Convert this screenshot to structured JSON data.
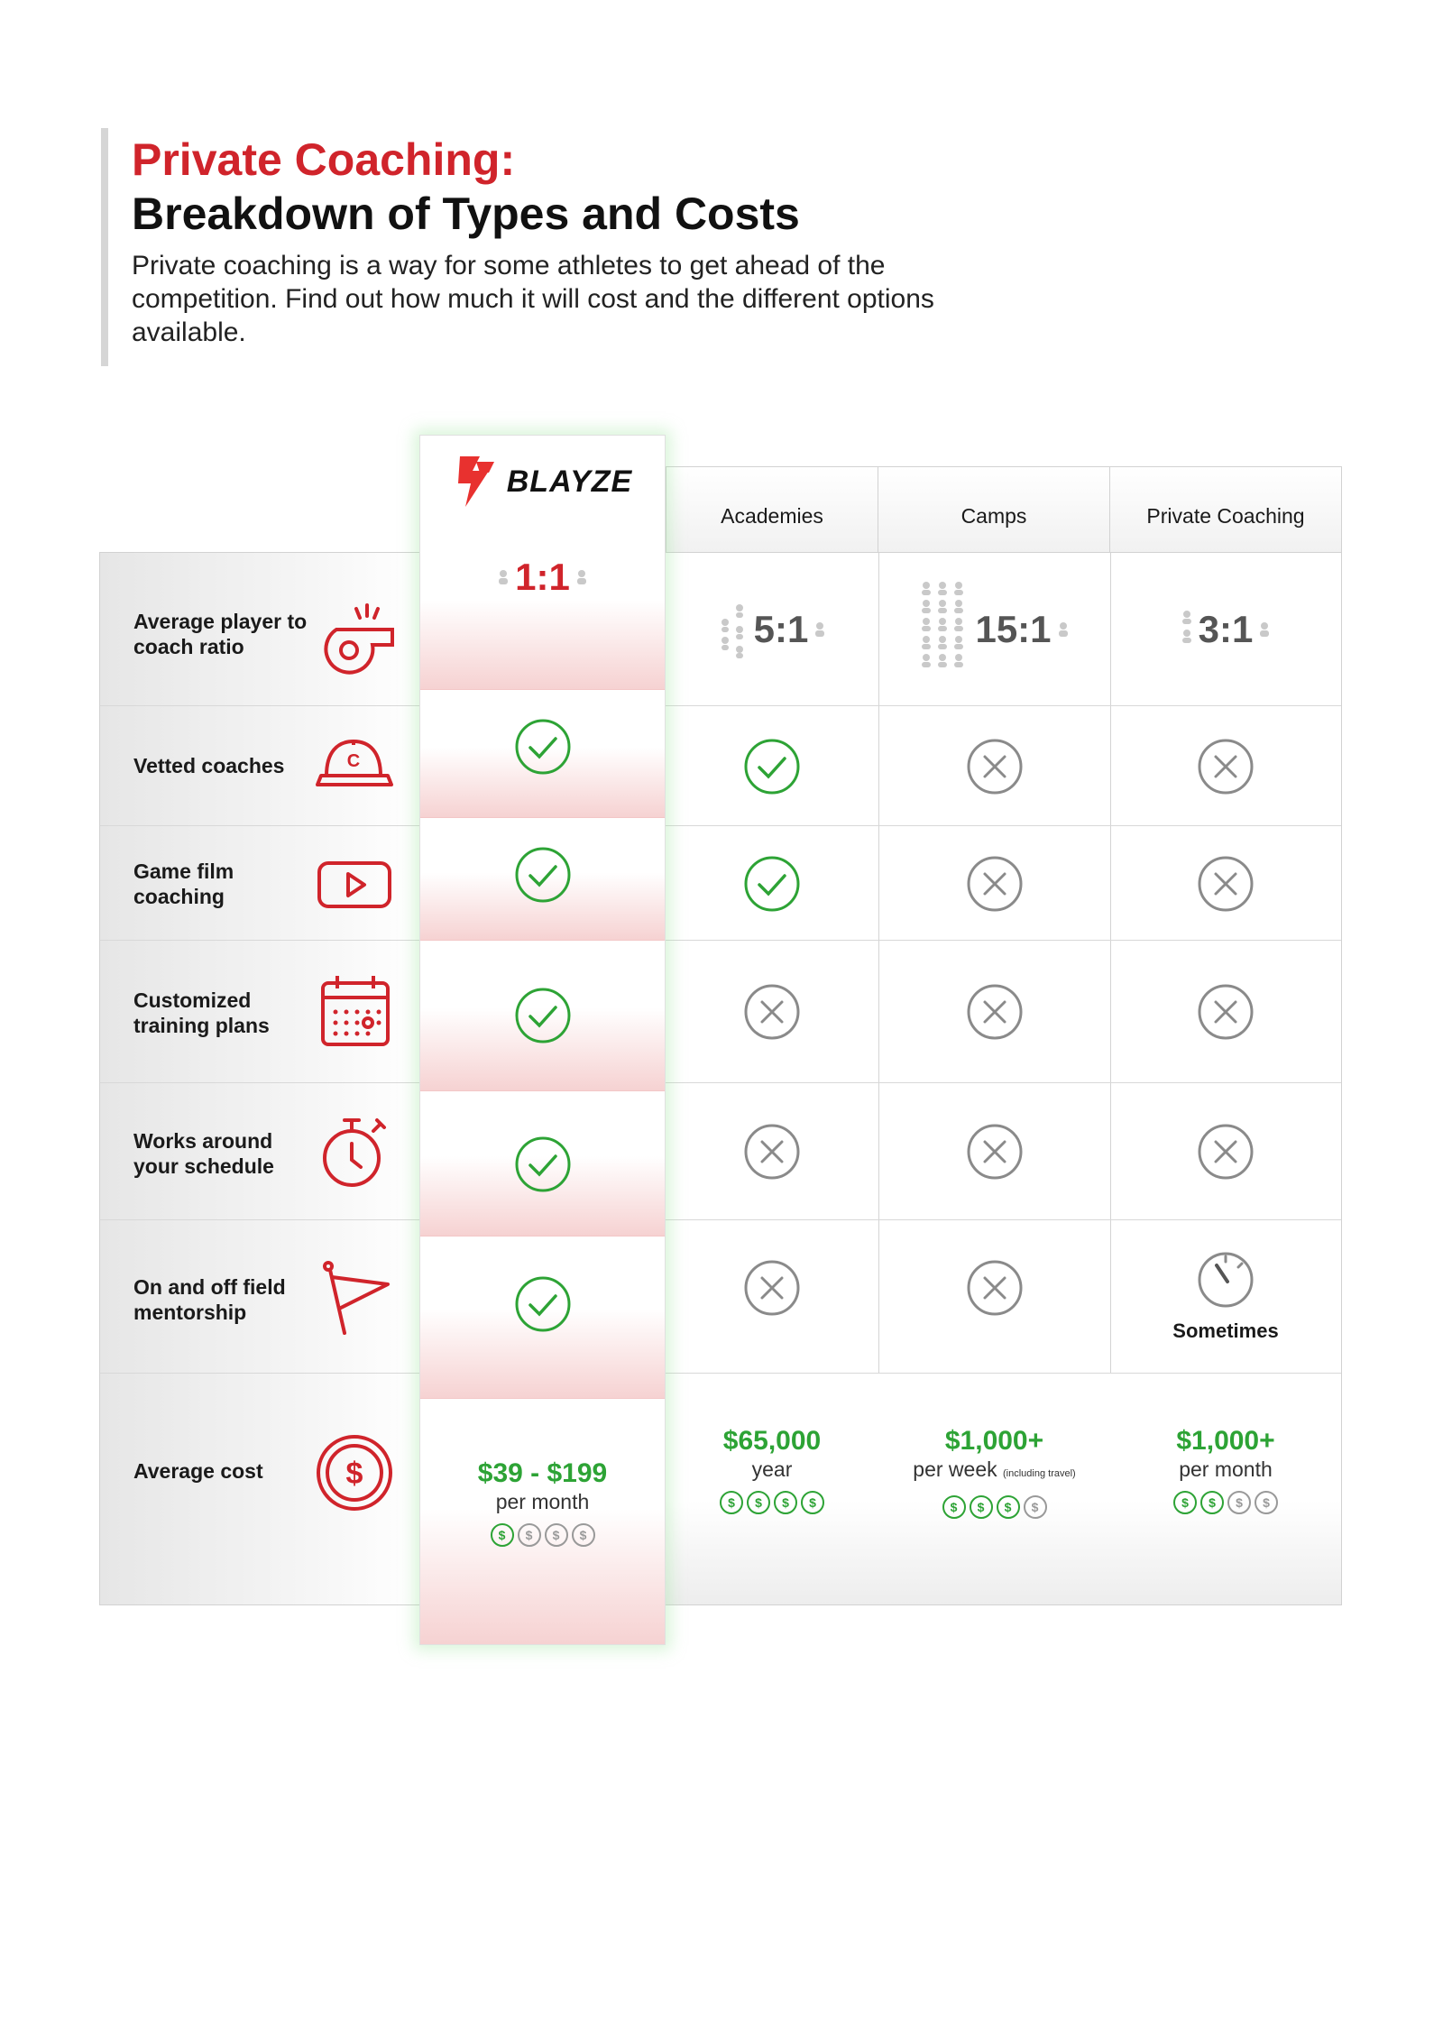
{
  "header": {
    "title_line1": "Private Coaching:",
    "title_line2": "Breakdown of Types and Costs",
    "intro": "Private coaching is a way for some athletes to get ahead of the competition. Find out how much it will cost and the different options available."
  },
  "columns": {
    "blayze": "BLAYZE",
    "academies": "Academies",
    "camps": "Camps",
    "private": "Private Coaching"
  },
  "rows": {
    "ratio": {
      "label": "Average  player to coach ratio",
      "icon": "whistle-icon"
    },
    "vetted": {
      "label": "Vetted coaches",
      "icon": "coach-cap-icon"
    },
    "film": {
      "label": "Game film coaching",
      "icon": "play-video-icon"
    },
    "plans": {
      "label": "Customized training plans",
      "icon": "calendar-icon"
    },
    "schedule": {
      "label": "Works around your schedule",
      "icon": "stopwatch-icon"
    },
    "mentor": {
      "label": "On and off field mentorship",
      "icon": "flag-icon"
    },
    "cost": {
      "label": "Average cost",
      "icon": "dollar-coin-icon"
    }
  },
  "ratios": {
    "blayze": "1:1",
    "academies": "5:1",
    "camps": "15:1",
    "private": "3:1"
  },
  "sometimes": "Sometimes",
  "costs": {
    "blayze": {
      "amount": "$39 - $199",
      "per": "per month",
      "level": 1
    },
    "academies": {
      "amount": "$65,000",
      "per": "year",
      "level": 4
    },
    "camps": {
      "amount": "$1,000+",
      "per": "per week",
      "note": "(including travel)",
      "level": 3
    },
    "private": {
      "amount": "$1,000+",
      "per": "per month",
      "level": 2
    }
  },
  "coin_symbol": "$",
  "colors": {
    "brand_red": "#d0242b",
    "check_green": "#2da335",
    "cross_gray": "#8a8a8a"
  }
}
